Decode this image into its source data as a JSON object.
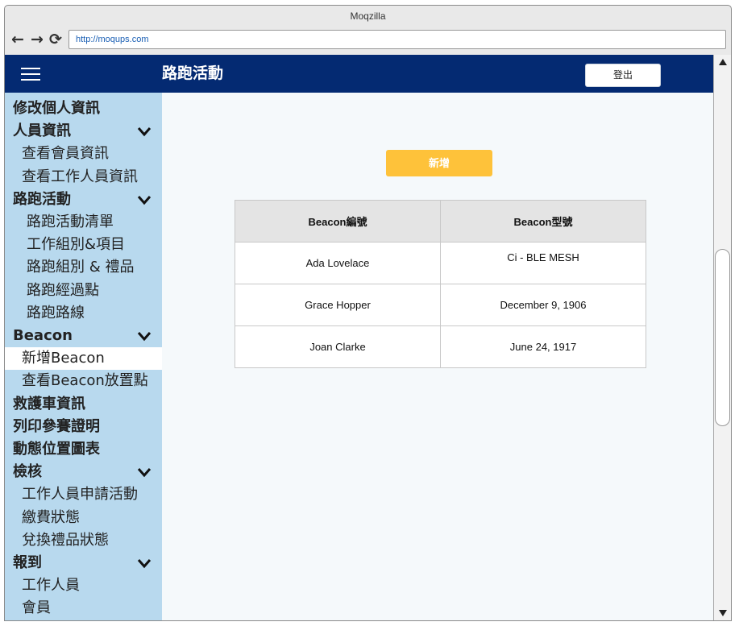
{
  "browser": {
    "title": "Moqzilla",
    "url": "http://moqups.com",
    "back_icon": "arrow-left-icon",
    "forward_icon": "arrow-right-icon",
    "reload_icon": "reload-icon"
  },
  "header": {
    "title": "路跑活動",
    "logout_label": "登出",
    "bg_color": "#042a72"
  },
  "sidebar": {
    "items": [
      {
        "label": "修改個人資訊",
        "type": "section",
        "chevron": false
      },
      {
        "label": "人員資訊",
        "type": "section",
        "chevron": true
      },
      {
        "label": "查看會員資訊",
        "type": "sub"
      },
      {
        "label": "查看工作人員資訊",
        "type": "sub"
      },
      {
        "label": "路跑活動",
        "type": "section",
        "chevron": true
      },
      {
        "label": "路跑活動清單",
        "type": "sub2"
      },
      {
        "label": "工作組別&項目",
        "type": "sub2"
      },
      {
        "label": "路跑組別 & 禮品",
        "type": "sub2"
      },
      {
        "label": "路跑經過點",
        "type": "sub2"
      },
      {
        "label": "路跑路線",
        "type": "sub2"
      },
      {
        "label": "Beacon",
        "type": "section",
        "chevron": true
      },
      {
        "label": "新增Beacon",
        "type": "sub",
        "active": true
      },
      {
        "label": "查看Beacon放置點",
        "type": "sub"
      },
      {
        "label": "救護車資訊",
        "type": "section",
        "chevron": false
      },
      {
        "label": "列印參賽證明",
        "type": "section",
        "chevron": false
      },
      {
        "label": "動態位置圖表",
        "type": "section",
        "chevron": false
      },
      {
        "label": "檢核",
        "type": "section",
        "chevron": true
      },
      {
        "label": "工作人員申請活動",
        "type": "sub"
      },
      {
        "label": "繳費狀態",
        "type": "sub"
      },
      {
        "label": "兌換禮品狀態",
        "type": "sub"
      },
      {
        "label": "報到",
        "type": "section",
        "chevron": true
      },
      {
        "label": "工作人員",
        "type": "sub"
      },
      {
        "label": "會員",
        "type": "sub"
      }
    ],
    "bg_color": "#b8d9ee"
  },
  "main": {
    "add_button_label": "新增",
    "add_button_color": "#fec23a",
    "table": {
      "columns": [
        "Beacon編號",
        "Beacon型號"
      ],
      "rows": [
        [
          "Ada Lovelace",
          "Ci - BLE MESH"
        ],
        [
          "Grace Hopper",
          "December 9, 1906"
        ],
        [
          "Joan Clarke",
          "June 24, 1917"
        ]
      ]
    }
  }
}
